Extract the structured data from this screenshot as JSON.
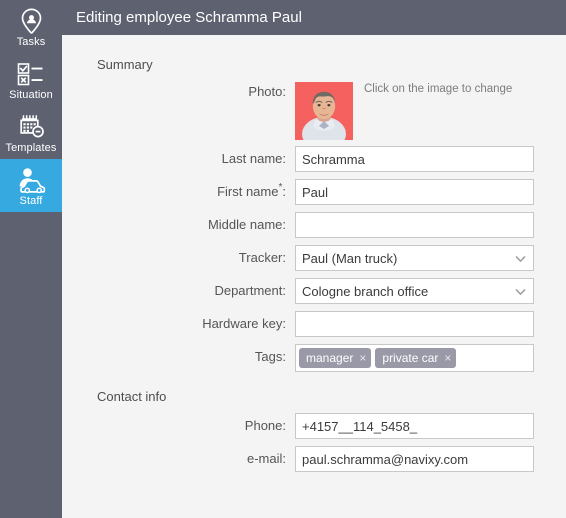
{
  "colors": {
    "chrome": "#5e6170",
    "accent": "#35a9e0",
    "content_bg": "#f4f4f4",
    "tag_bg": "#9a99a8",
    "photo_bg": "#f4615f"
  },
  "sidebar": {
    "items": [
      {
        "label": "Tasks",
        "icon": "person-pin-icon",
        "active": false
      },
      {
        "label": "Situation",
        "icon": "checklist-icon",
        "active": false
      },
      {
        "label": "Templates",
        "icon": "calendar-clock-icon",
        "active": false
      },
      {
        "label": "Staff",
        "icon": "person-car-icon",
        "active": true
      }
    ]
  },
  "header": {
    "title": "Editing employee Schramma Paul"
  },
  "summary": {
    "section_label": "Summary",
    "photo": {
      "label": "Photo:",
      "hint": "Click on the image to change"
    },
    "fields": [
      {
        "label": "Last name:",
        "value": "Schramma",
        "type": "text",
        "required": false
      },
      {
        "label": "First name",
        "suffix": ":",
        "value": "Paul",
        "type": "text",
        "required": true,
        "required_mark": "*"
      },
      {
        "label": "Middle name:",
        "value": "",
        "type": "text",
        "required": false
      },
      {
        "label": "Tracker:",
        "value": "Paul (Man truck)",
        "type": "select",
        "required": false
      },
      {
        "label": "Department:",
        "value": "Cologne branch office",
        "type": "select",
        "required": false
      },
      {
        "label": "Hardware key:",
        "value": "",
        "type": "text",
        "required": false
      }
    ],
    "tags": {
      "label": "Tags:",
      "items": [
        {
          "text": "manager",
          "remove": "×"
        },
        {
          "text": "private car",
          "remove": "×"
        }
      ]
    }
  },
  "contact": {
    "section_label": "Contact info",
    "fields": [
      {
        "label": "Phone:",
        "value": "+4157__114_5458_",
        "type": "text"
      },
      {
        "label": "e-mail:",
        "value": "paul.schramma@navixy.com",
        "type": "text"
      }
    ]
  }
}
